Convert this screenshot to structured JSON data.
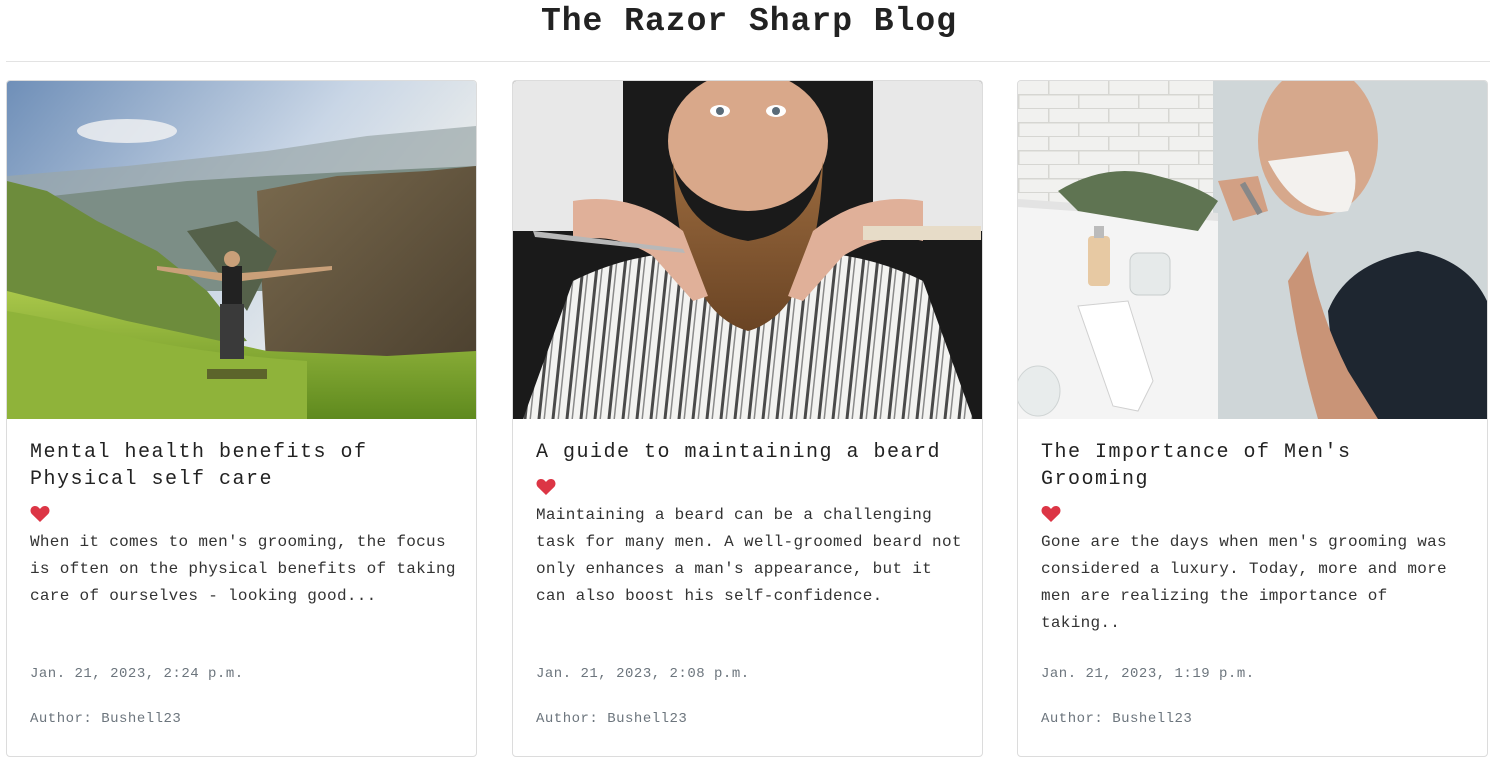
{
  "site": {
    "title": "The Razor Sharp Blog"
  },
  "theme": {
    "heart_color": "#dc3545",
    "meta_color": "#6c757d",
    "border_color": "#dcdcdc"
  },
  "posts": [
    {
      "image_alt": "Man with arms outstretched on a grassy hillside overlooking a mountain canyon",
      "title": "Mental health benefits of Physical self care",
      "like_icon": "heart-icon",
      "excerpt": "When it comes to men's grooming, the focus is often on the physical benefits of taking care of ourselves - looking good...",
      "date": "Jan. 21, 2023, 2:24 p.m.",
      "author": "Author: Bushell23"
    },
    {
      "image_alt": "Barber holding scissors and trimming a man's full beard",
      "title": "A guide to maintaining a beard",
      "like_icon": "heart-icon",
      "excerpt": "Maintaining a beard can be a challenging task for many men. A well-groomed beard not only enhances a man's appearance, but it can also boost his self-confidence.",
      "date": "Jan. 21, 2023, 2:08 p.m.",
      "author": "Author: Bushell23"
    },
    {
      "image_alt": "Man shaving with shaving cream on his face beside a white windowsill",
      "title": "The Importance of Men's Grooming",
      "like_icon": "heart-icon",
      "excerpt": "Gone are the days when men's grooming was considered a luxury. Today, more and more men are realizing the importance of taking..",
      "date": "Jan. 21, 2023, 1:19 p.m.",
      "author": "Author: Bushell23"
    }
  ]
}
